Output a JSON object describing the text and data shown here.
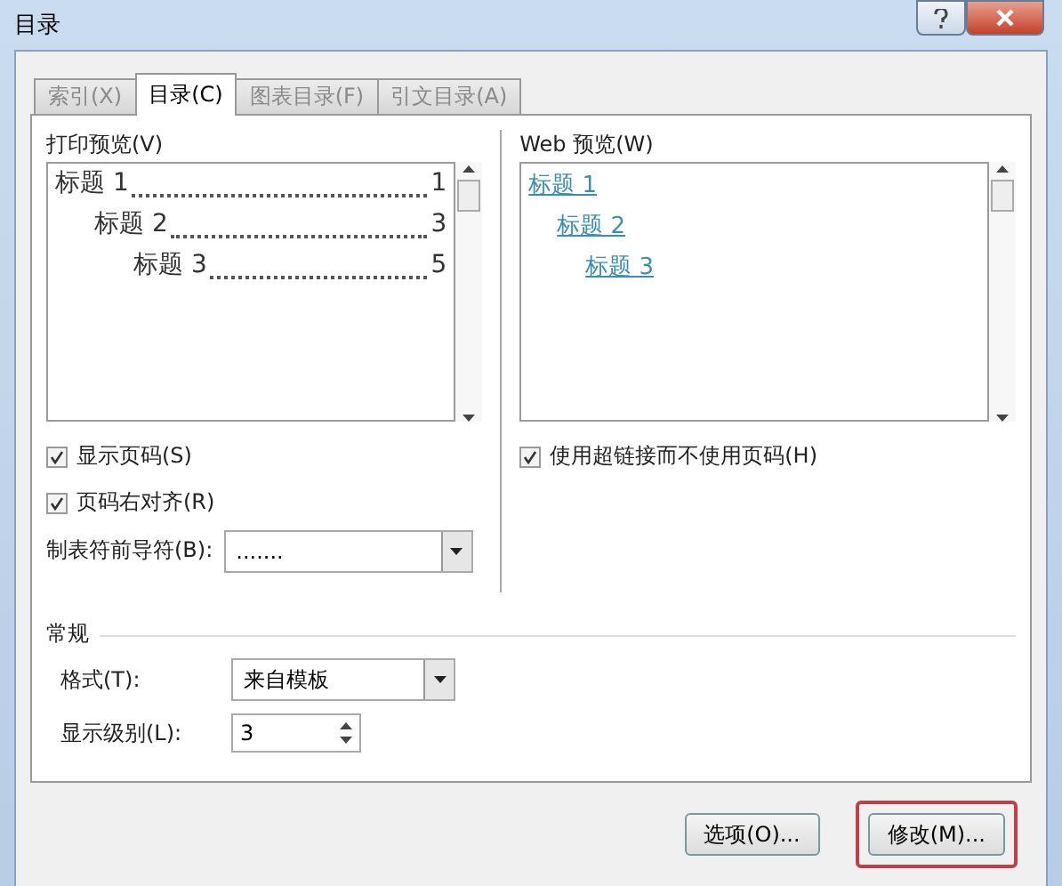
{
  "window": {
    "title": "目录"
  },
  "tabs": [
    {
      "label": "索引(X)",
      "selected": false
    },
    {
      "label": "目录(C)",
      "selected": true
    },
    {
      "label": "图表目录(F)",
      "selected": false
    },
    {
      "label": "引文目录(A)",
      "selected": false
    }
  ],
  "print_preview": {
    "label": "打印预览(V)",
    "entries": [
      {
        "text": "标题 1",
        "page": "1",
        "children": [
          {
            "text": "标题 2",
            "page": "3",
            "children": [
              {
                "text": "标题 3",
                "page": "5"
              }
            ]
          }
        ]
      }
    ]
  },
  "print_options": [
    {
      "label": "显示页码(S)",
      "checked": true
    },
    {
      "label": "页码右对齐(R)",
      "checked": true
    }
  ],
  "tab_leader": {
    "label": "制表符前导符(B):",
    "value": "......."
  },
  "web_preview": {
    "label": "Web 预览(W)",
    "entries": [
      {
        "text": "标题 1",
        "children": [
          {
            "text": "标题 2",
            "children": [
              {
                "text": "标题 3"
              }
            ]
          }
        ]
      }
    ]
  },
  "web_options": [
    {
      "label": "使用超链接而不使用页码(H)",
      "checked": true
    }
  ],
  "general": {
    "title": "常规",
    "format": {
      "label": "格式(T):",
      "value": "来自模板"
    },
    "levels": {
      "label": "显示级别(L):",
      "value": "3"
    }
  },
  "buttons": [
    {
      "label": "选项(O)...",
      "highlighted": false
    },
    {
      "label": "修改(M)...",
      "highlighted": true
    }
  ]
}
